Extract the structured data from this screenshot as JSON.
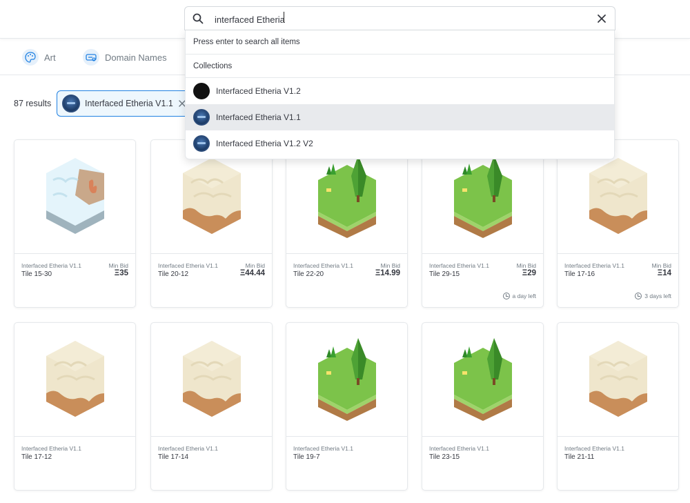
{
  "search": {
    "value": "interfaced Etheria"
  },
  "categories": [
    {
      "label": "Art",
      "icon": "art-icon"
    },
    {
      "label": "Domain Names",
      "icon": "domain-names-icon"
    }
  ],
  "dropdown": {
    "hint": "Press enter to search all items",
    "section": "Collections",
    "items": [
      {
        "label": "Interfaced Etheria V1.2",
        "avatar": "black"
      },
      {
        "label": "Interfaced Etheria V1.1",
        "avatar": "blue",
        "highlighted": true
      },
      {
        "label": "Interfaced Etheria V1.2 V2",
        "avatar": "blue"
      }
    ]
  },
  "results": {
    "count": "87 results",
    "filter": "Interfaced Etheria V1.1"
  },
  "labels": {
    "min_bid": "Min Bid"
  },
  "cards": [
    {
      "collection": "Interfaced Etheria V1.1",
      "name": "Tile 15-30",
      "bid": "Ξ35",
      "time_left": "",
      "tile": "snow"
    },
    {
      "collection": "Interfaced Etheria V1.1",
      "name": "Tile 20-12",
      "bid": "Ξ44.44",
      "time_left": "",
      "tile": "desert"
    },
    {
      "collection": "Interfaced Etheria V1.1",
      "name": "Tile 22-20",
      "bid": "Ξ14.99",
      "time_left": "",
      "tile": "grass"
    },
    {
      "collection": "Interfaced Etheria V1.1",
      "name": "Tile 29-15",
      "bid": "Ξ29",
      "time_left": "a day left",
      "tile": "grass"
    },
    {
      "collection": "Interfaced Etheria V1.1",
      "name": "Tile 17-16",
      "bid": "Ξ14",
      "time_left": "3 days left",
      "tile": "desert"
    },
    {
      "collection": "Interfaced Etheria V1.1",
      "name": "Tile 17-12",
      "bid": "",
      "time_left": "",
      "tile": "desert"
    },
    {
      "collection": "Interfaced Etheria V1.1",
      "name": "Tile 17-14",
      "bid": "",
      "time_left": "",
      "tile": "desert"
    },
    {
      "collection": "Interfaced Etheria V1.1",
      "name": "Tile 19-7",
      "bid": "",
      "time_left": "",
      "tile": "grass"
    },
    {
      "collection": "Interfaced Etheria V1.1",
      "name": "Tile 23-15",
      "bid": "",
      "time_left": "",
      "tile": "grass"
    },
    {
      "collection": "Interfaced Etheria V1.1",
      "name": "Tile 21-11",
      "bid": "",
      "time_left": "",
      "tile": "desert"
    }
  ],
  "colors": {
    "accent": "#2081e2",
    "desert_top": "#efe6cc",
    "desert_side": "#c98e5a",
    "grass_top": "#7cc34a",
    "dirt": "#b07a46",
    "snow_top": "#e4f4fb"
  }
}
